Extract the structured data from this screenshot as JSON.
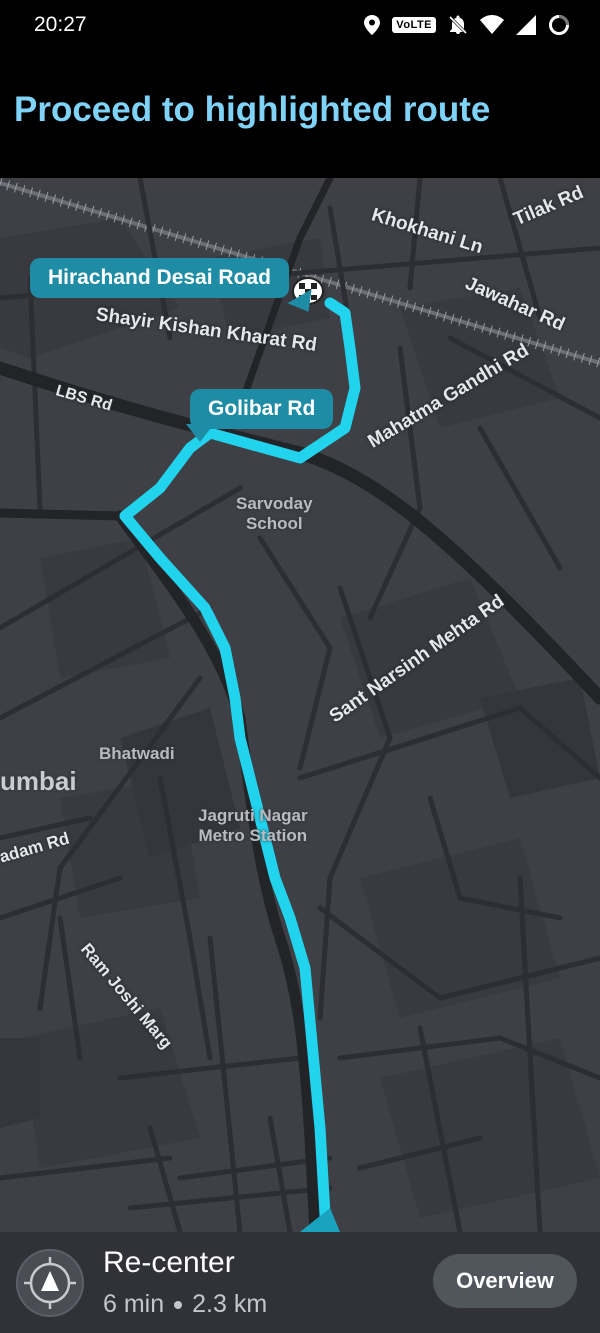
{
  "status_bar": {
    "time": "20:27",
    "volte_label": "VoLTE",
    "icons": [
      "location-icon",
      "volte-icon",
      "bell-off-icon",
      "wifi-icon",
      "signal-icon",
      "battery-icon"
    ]
  },
  "banner": {
    "title": "Proceed to highlighted route",
    "color": "#7fd3f8"
  },
  "map": {
    "route_color": "#22d3ee",
    "callouts": {
      "hirachand": "Hirachand Desai Road",
      "golibar": "Golibar Rd"
    },
    "streets": {
      "khokhani": "Khokhani Ln",
      "tilak": "Tilak Rd",
      "jawahar": "Jawahar Rd",
      "shayir": "Shayir Kishan Kharat Rd",
      "mahatma": "Mahatma Gandhi Rd",
      "lbs": "LBS Rd",
      "sant": "Sant Narsinh Mehta Rd",
      "adam": "adam Rd",
      "ram": "Ram Joshi Marg"
    },
    "pois": {
      "sarvoday": "Sarvoday\nSchool",
      "bhatwadi": "Bhatwadi",
      "jagruti": "Jagruti Nagar\nMetro Station"
    },
    "city": "umbai"
  },
  "bottom_bar": {
    "recenter_label": "Re-center",
    "eta": "6 min",
    "distance": "2.3 km",
    "overview_label": "Overview"
  }
}
